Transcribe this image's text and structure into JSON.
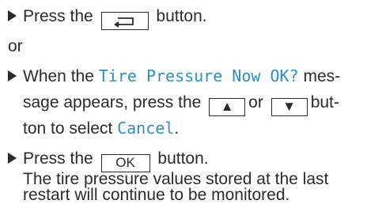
{
  "step1": {
    "pre": "Press the",
    "post": "button.",
    "key_icon": "back-arrow-icon"
  },
  "or_label": "or",
  "step2": {
    "line1_pre": "When the",
    "message": "Tire Pressure Now OK?",
    "line1_post": "mes-",
    "line2_pre": "sage appears, press the",
    "up_key": "▲",
    "or_word": "or",
    "down_key": "▼",
    "line2_post": "but-",
    "line3_pre": "ton to select",
    "option": "Cancel",
    "line3_post": "."
  },
  "step3": {
    "pre": "Press the",
    "ok_key": "OK",
    "post": "button.",
    "result_line1": "The tire pressure values stored at the last",
    "result_line2": "restart will continue to be monitored."
  },
  "colors": {
    "text": "#2b2b2b",
    "highlight": "#2f8fc0"
  }
}
